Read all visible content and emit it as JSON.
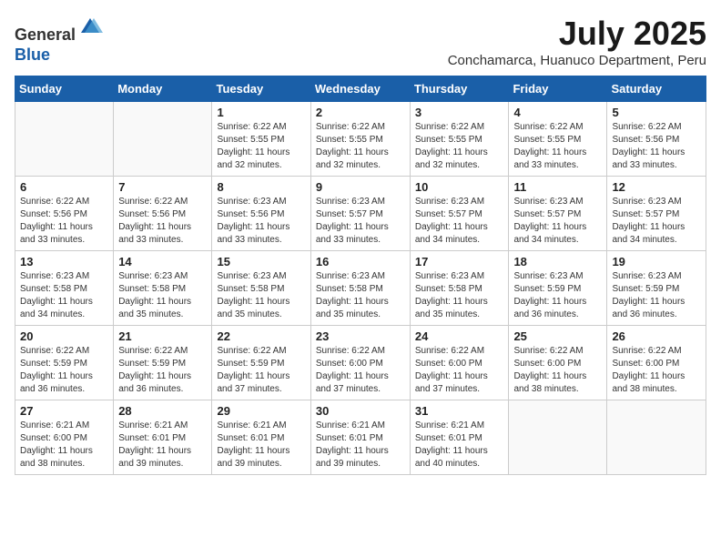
{
  "logo": {
    "general": "General",
    "blue": "Blue"
  },
  "header": {
    "month": "July 2025",
    "location": "Conchamarca, Huanuco Department, Peru"
  },
  "weekdays": [
    "Sunday",
    "Monday",
    "Tuesday",
    "Wednesday",
    "Thursday",
    "Friday",
    "Saturday"
  ],
  "weeks": [
    [
      {
        "day": "",
        "sunrise": "",
        "sunset": "",
        "daylight": ""
      },
      {
        "day": "",
        "sunrise": "",
        "sunset": "",
        "daylight": ""
      },
      {
        "day": "1",
        "sunrise": "Sunrise: 6:22 AM",
        "sunset": "Sunset: 5:55 PM",
        "daylight": "Daylight: 11 hours and 32 minutes."
      },
      {
        "day": "2",
        "sunrise": "Sunrise: 6:22 AM",
        "sunset": "Sunset: 5:55 PM",
        "daylight": "Daylight: 11 hours and 32 minutes."
      },
      {
        "day": "3",
        "sunrise": "Sunrise: 6:22 AM",
        "sunset": "Sunset: 5:55 PM",
        "daylight": "Daylight: 11 hours and 32 minutes."
      },
      {
        "day": "4",
        "sunrise": "Sunrise: 6:22 AM",
        "sunset": "Sunset: 5:55 PM",
        "daylight": "Daylight: 11 hours and 33 minutes."
      },
      {
        "day": "5",
        "sunrise": "Sunrise: 6:22 AM",
        "sunset": "Sunset: 5:56 PM",
        "daylight": "Daylight: 11 hours and 33 minutes."
      }
    ],
    [
      {
        "day": "6",
        "sunrise": "Sunrise: 6:22 AM",
        "sunset": "Sunset: 5:56 PM",
        "daylight": "Daylight: 11 hours and 33 minutes."
      },
      {
        "day": "7",
        "sunrise": "Sunrise: 6:22 AM",
        "sunset": "Sunset: 5:56 PM",
        "daylight": "Daylight: 11 hours and 33 minutes."
      },
      {
        "day": "8",
        "sunrise": "Sunrise: 6:23 AM",
        "sunset": "Sunset: 5:56 PM",
        "daylight": "Daylight: 11 hours and 33 minutes."
      },
      {
        "day": "9",
        "sunrise": "Sunrise: 6:23 AM",
        "sunset": "Sunset: 5:57 PM",
        "daylight": "Daylight: 11 hours and 33 minutes."
      },
      {
        "day": "10",
        "sunrise": "Sunrise: 6:23 AM",
        "sunset": "Sunset: 5:57 PM",
        "daylight": "Daylight: 11 hours and 34 minutes."
      },
      {
        "day": "11",
        "sunrise": "Sunrise: 6:23 AM",
        "sunset": "Sunset: 5:57 PM",
        "daylight": "Daylight: 11 hours and 34 minutes."
      },
      {
        "day": "12",
        "sunrise": "Sunrise: 6:23 AM",
        "sunset": "Sunset: 5:57 PM",
        "daylight": "Daylight: 11 hours and 34 minutes."
      }
    ],
    [
      {
        "day": "13",
        "sunrise": "Sunrise: 6:23 AM",
        "sunset": "Sunset: 5:58 PM",
        "daylight": "Daylight: 11 hours and 34 minutes."
      },
      {
        "day": "14",
        "sunrise": "Sunrise: 6:23 AM",
        "sunset": "Sunset: 5:58 PM",
        "daylight": "Daylight: 11 hours and 35 minutes."
      },
      {
        "day": "15",
        "sunrise": "Sunrise: 6:23 AM",
        "sunset": "Sunset: 5:58 PM",
        "daylight": "Daylight: 11 hours and 35 minutes."
      },
      {
        "day": "16",
        "sunrise": "Sunrise: 6:23 AM",
        "sunset": "Sunset: 5:58 PM",
        "daylight": "Daylight: 11 hours and 35 minutes."
      },
      {
        "day": "17",
        "sunrise": "Sunrise: 6:23 AM",
        "sunset": "Sunset: 5:58 PM",
        "daylight": "Daylight: 11 hours and 35 minutes."
      },
      {
        "day": "18",
        "sunrise": "Sunrise: 6:23 AM",
        "sunset": "Sunset: 5:59 PM",
        "daylight": "Daylight: 11 hours and 36 minutes."
      },
      {
        "day": "19",
        "sunrise": "Sunrise: 6:23 AM",
        "sunset": "Sunset: 5:59 PM",
        "daylight": "Daylight: 11 hours and 36 minutes."
      }
    ],
    [
      {
        "day": "20",
        "sunrise": "Sunrise: 6:22 AM",
        "sunset": "Sunset: 5:59 PM",
        "daylight": "Daylight: 11 hours and 36 minutes."
      },
      {
        "day": "21",
        "sunrise": "Sunrise: 6:22 AM",
        "sunset": "Sunset: 5:59 PM",
        "daylight": "Daylight: 11 hours and 36 minutes."
      },
      {
        "day": "22",
        "sunrise": "Sunrise: 6:22 AM",
        "sunset": "Sunset: 5:59 PM",
        "daylight": "Daylight: 11 hours and 37 minutes."
      },
      {
        "day": "23",
        "sunrise": "Sunrise: 6:22 AM",
        "sunset": "Sunset: 6:00 PM",
        "daylight": "Daylight: 11 hours and 37 minutes."
      },
      {
        "day": "24",
        "sunrise": "Sunrise: 6:22 AM",
        "sunset": "Sunset: 6:00 PM",
        "daylight": "Daylight: 11 hours and 37 minutes."
      },
      {
        "day": "25",
        "sunrise": "Sunrise: 6:22 AM",
        "sunset": "Sunset: 6:00 PM",
        "daylight": "Daylight: 11 hours and 38 minutes."
      },
      {
        "day": "26",
        "sunrise": "Sunrise: 6:22 AM",
        "sunset": "Sunset: 6:00 PM",
        "daylight": "Daylight: 11 hours and 38 minutes."
      }
    ],
    [
      {
        "day": "27",
        "sunrise": "Sunrise: 6:21 AM",
        "sunset": "Sunset: 6:00 PM",
        "daylight": "Daylight: 11 hours and 38 minutes."
      },
      {
        "day": "28",
        "sunrise": "Sunrise: 6:21 AM",
        "sunset": "Sunset: 6:01 PM",
        "daylight": "Daylight: 11 hours and 39 minutes."
      },
      {
        "day": "29",
        "sunrise": "Sunrise: 6:21 AM",
        "sunset": "Sunset: 6:01 PM",
        "daylight": "Daylight: 11 hours and 39 minutes."
      },
      {
        "day": "30",
        "sunrise": "Sunrise: 6:21 AM",
        "sunset": "Sunset: 6:01 PM",
        "daylight": "Daylight: 11 hours and 39 minutes."
      },
      {
        "day": "31",
        "sunrise": "Sunrise: 6:21 AM",
        "sunset": "Sunset: 6:01 PM",
        "daylight": "Daylight: 11 hours and 40 minutes."
      },
      {
        "day": "",
        "sunrise": "",
        "sunset": "",
        "daylight": ""
      },
      {
        "day": "",
        "sunrise": "",
        "sunset": "",
        "daylight": ""
      }
    ]
  ]
}
